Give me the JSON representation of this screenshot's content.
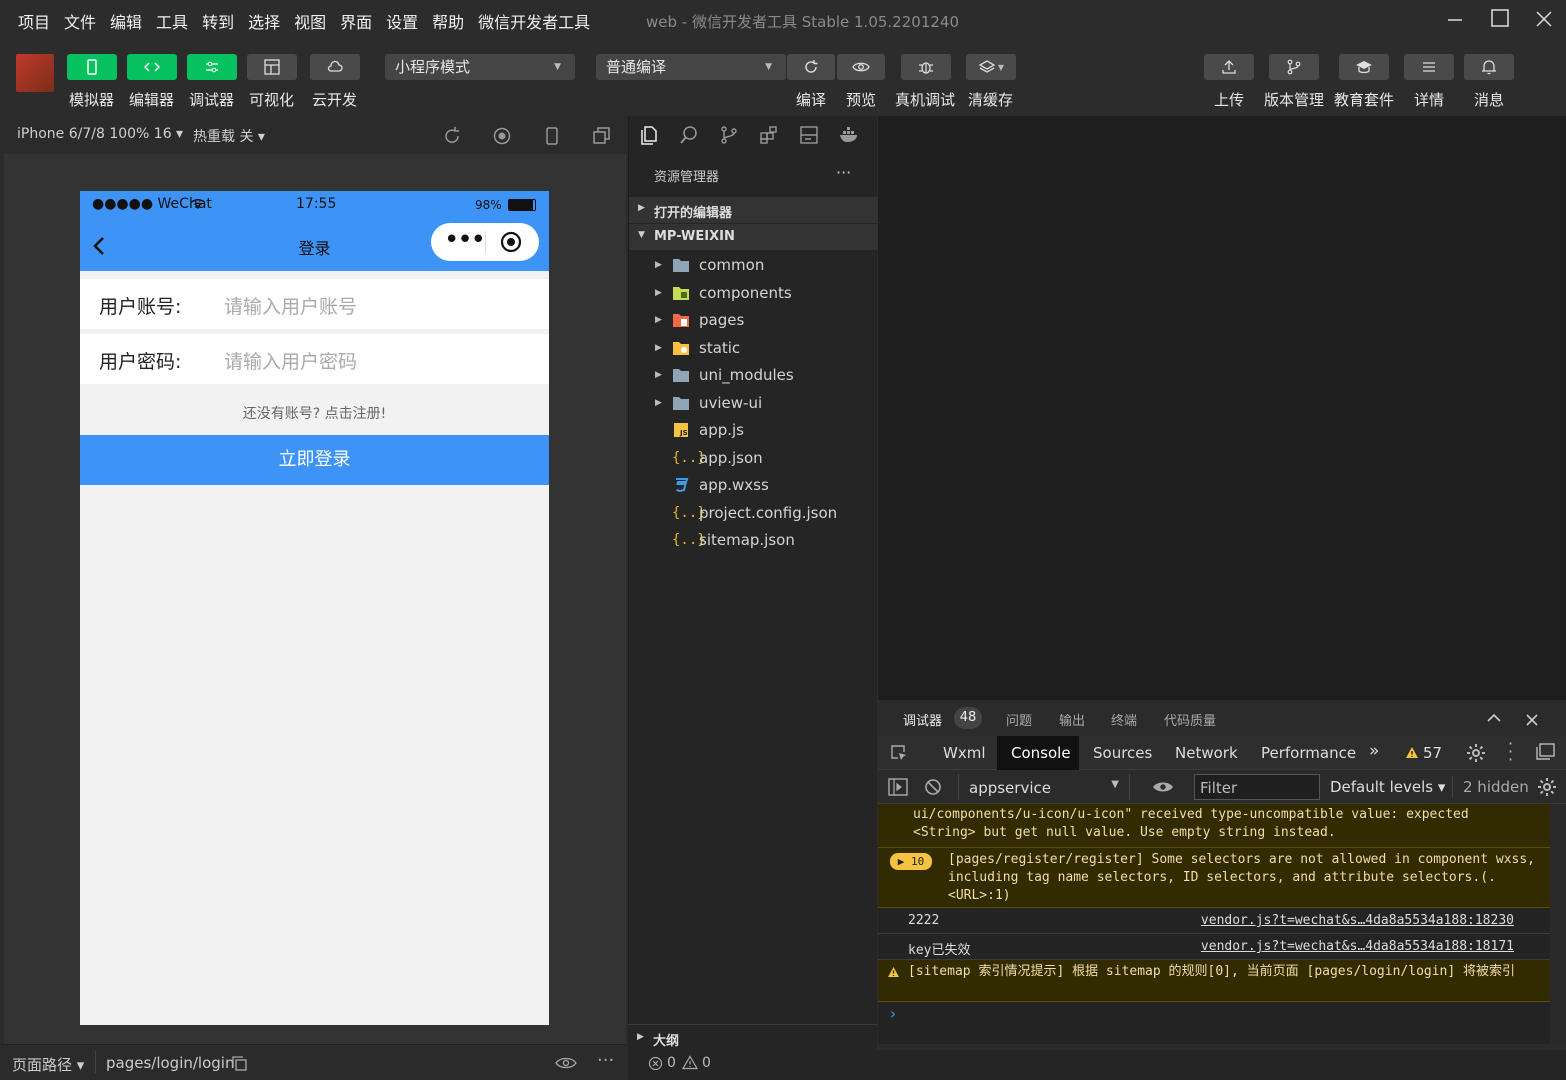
{
  "menu": [
    "项目",
    "文件",
    "编辑",
    "工具",
    "转到",
    "选择",
    "视图",
    "界面",
    "设置",
    "帮助",
    "微信开发者工具"
  ],
  "window_title": "web - 微信开发者工具 Stable 1.05.2201240",
  "toolbar": {
    "simulator": "模拟器",
    "editor": "编辑器",
    "debugger": "调试器",
    "visual": "可视化",
    "cloud": "云开发",
    "mode_select": "小程序模式",
    "compile_select": "普通编译",
    "compile": "编译",
    "preview": "预览",
    "real_debug": "真机调试",
    "clear_cache": "清缓存",
    "upload": "上传",
    "version": "版本管理",
    "edu": "教育套件",
    "details": "详情",
    "messages": "消息"
  },
  "simbar": {
    "device": "iPhone 6/7/8 100% 16 ▾",
    "hot_reload": "热重载 关 ▾"
  },
  "phone": {
    "signal": "●●●●● WeChat",
    "time": "17:55",
    "battery": "98%",
    "nav_title": "登录",
    "account_label": "用户账号:",
    "account_placeholder": "请输入用户账号",
    "password_label": "用户密码:",
    "password_placeholder": "请输入用户密码",
    "register_tip": "还没有账号? 点击注册!",
    "login_button": "立即登录"
  },
  "sim_footer": {
    "route_label": "页面路径 ▾",
    "route": "pages/login/login"
  },
  "explorer": {
    "title": "资源管理器",
    "more": "···",
    "open_editors": "打开的编辑器",
    "project": "MP-WEIXIN",
    "outline": "大纲",
    "items": [
      {
        "name": "common",
        "type": "folder"
      },
      {
        "name": "components",
        "type": "folder"
      },
      {
        "name": "pages",
        "type": "folder"
      },
      {
        "name": "static",
        "type": "folder"
      },
      {
        "name": "uni_modules",
        "type": "folder"
      },
      {
        "name": "uview-ui",
        "type": "folder"
      },
      {
        "name": "app.js",
        "type": "js"
      },
      {
        "name": "app.json",
        "type": "json"
      },
      {
        "name": "app.wxss",
        "type": "css"
      },
      {
        "name": "project.config.json",
        "type": "json"
      },
      {
        "name": "sitemap.json",
        "type": "json"
      }
    ]
  },
  "devtools": {
    "tabs": {
      "debugger": "调试器",
      "badge": "48",
      "issues": "问题",
      "output": "输出",
      "terminal": "终端",
      "quality": "代码质量"
    },
    "panels": {
      "wxml": "Wxml",
      "console": "Console",
      "sources": "Sources",
      "network": "Network",
      "performance": "Performance",
      "more": "»",
      "warn_count": "57"
    },
    "filter": {
      "context": "appservice",
      "filter_placeholder": "Filter",
      "levels": "Default levels ▾",
      "hidden": "2 hidden"
    },
    "messages": {
      "m1": "ui/components/u-icon/u-icon\" received type-uncompatible value: expected <String> but get null value. Use empty string instead.",
      "m2_badge": "10",
      "m2": "[pages/register/register] Some selectors are not allowed in component wxss, including tag name selectors, ID selectors, and attribute selectors.(.<URL>:1)",
      "m3": "2222",
      "m3_link": "vendor.js?t=wechat&s…4da8a5534a188:18230",
      "m4": "key已失效",
      "m4_link": "vendor.js?t=wechat&s…4da8a5534a188:18171",
      "m5": "[sitemap 索引情况提示] 根据 sitemap 的规则[0], 当前页面 [pages/login/login] 将被索引",
      "prompt": "›"
    }
  },
  "status": {
    "errors": "0",
    "warnings": "0"
  },
  "colors": {
    "accent_green": "#07c160",
    "wechat_blue": "#3d94f6"
  }
}
